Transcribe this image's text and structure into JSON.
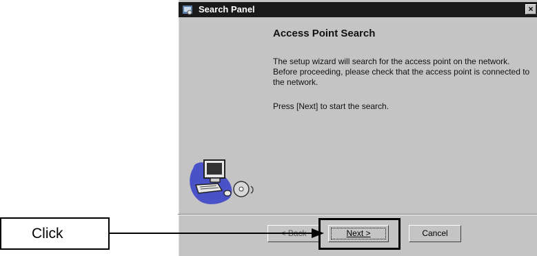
{
  "window": {
    "title": "Search Panel",
    "close_label": "×"
  },
  "content": {
    "heading": "Access Point Search",
    "paragraph1": "The setup wizard will search for the access point on the network. Before proceeding, please check that the access point is connected to the network.",
    "paragraph2": "Press [Next] to start the search."
  },
  "buttons": {
    "back": "< Back",
    "next": "Next >",
    "cancel": "Cancel"
  },
  "callout": {
    "label": "Click"
  },
  "icons": {
    "title": "app-icon",
    "clipart": "computer-cd-clipart",
    "close": "close-icon"
  },
  "colors": {
    "window_bg": "#c4c4c4",
    "titlebar": "#1a1a1a"
  }
}
